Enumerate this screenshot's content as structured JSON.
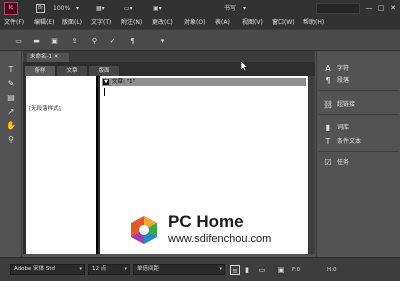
{
  "app": {
    "logo_text": "Ic",
    "bridge_text": "Br"
  },
  "topbar": {
    "zoom": "100%",
    "workspace": "书写",
    "win_minimize": "—",
    "win_maximize": "□",
    "win_close": "✕"
  },
  "menubar": {
    "items": [
      {
        "label": "文件(F)"
      },
      {
        "label": "编辑(E)"
      },
      {
        "label": "版面(L)"
      },
      {
        "label": "文字(T)"
      },
      {
        "label": "附注(N)"
      },
      {
        "label": "更改(C)"
      },
      {
        "label": "对象(O)"
      },
      {
        "label": "表(A)"
      },
      {
        "label": "视图(V)"
      },
      {
        "label": "窗口(W)"
      },
      {
        "label": "帮助(H)"
      }
    ]
  },
  "document": {
    "tab_title": "未命名-1 ✕"
  },
  "story_editor": {
    "tabs": [
      {
        "label": "条样"
      },
      {
        "label": "文章"
      },
      {
        "label": "版面"
      }
    ],
    "style_label": "[无段落样式]",
    "story_header": "文章: \"1\""
  },
  "watermark": {
    "title": "PC Home",
    "url": "www.sdifenchou.com"
  },
  "right_panel": {
    "items": [
      {
        "label": "字符",
        "icon": "A"
      },
      {
        "label": "段落",
        "icon": "¶"
      },
      {
        "label": "超链接",
        "icon": "⛓"
      },
      {
        "label": "词库",
        "icon": "▮"
      },
      {
        "label": "条件文本",
        "icon": "T"
      },
      {
        "label": "任务",
        "icon": "☑"
      }
    ]
  },
  "statusbar": {
    "font": "Adobe 宋体 Std",
    "size": "12 点",
    "spacing": "单倍间距",
    "f_value": "F:0",
    "h_value": "H:0"
  },
  "colors": {
    "accent": "#ff66a3",
    "chrome_dark": "#323232",
    "panel": "#535353"
  }
}
